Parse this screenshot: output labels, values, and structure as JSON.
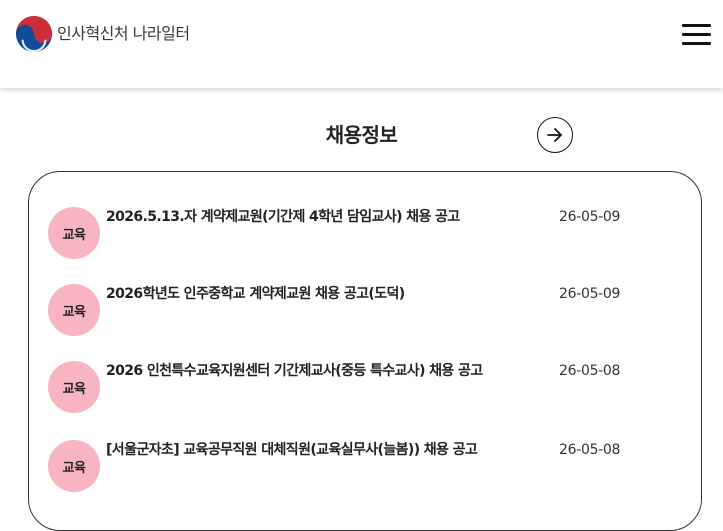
{
  "header": {
    "logo_text": "인사혁신처 나라일터"
  },
  "section": {
    "title": "채용정보"
  },
  "colors": {
    "badge_bg": "#f8b4c0",
    "taeguk_red": "#cd2e3a",
    "taeguk_blue": "#0f4c9c"
  },
  "jobs": [
    {
      "category": "교육",
      "title": "2026.5.13.자 계약제교원(기간제 4학년 담임교사) 채용 공고",
      "date": "26-05-09"
    },
    {
      "category": "교육",
      "title": "2026학년도 인주중학교 계약제교원 채용 공고(도덕)",
      "date": "26-05-09"
    },
    {
      "category": "교육",
      "title": "2026 인천특수교육지원센터 기간제교사(중등 특수교사) 채용 공고",
      "date": "26-05-08"
    },
    {
      "category": "교육",
      "title": "[서울군자초] 교육공무직원 대체직원(교육실무사(늘봄)) 채용 공고",
      "date": "26-05-08"
    }
  ]
}
